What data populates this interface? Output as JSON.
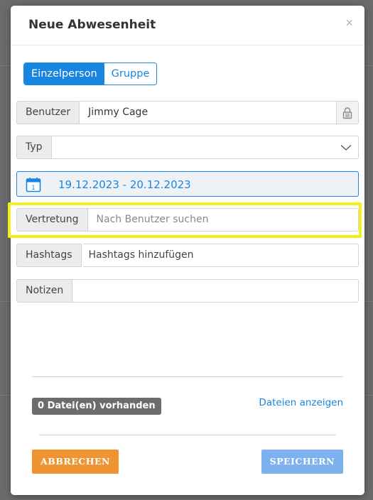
{
  "modal": {
    "title": "Neue Abwesenheit",
    "close_symbol": "×"
  },
  "toggle": {
    "options": [
      "Einzelperson",
      "Gruppe"
    ],
    "selected": "Einzelperson"
  },
  "fields": {
    "benutzer": {
      "label": "Benutzer",
      "value": "Jimmy Cage",
      "locked": true,
      "icon": "lock-icon"
    },
    "typ": {
      "label": "Typ",
      "value": "",
      "icon": "chevron-down-icon"
    },
    "date_range": {
      "value": "19.12.2023 - 20.12.2023",
      "icon": "calendar-icon",
      "calendar_day": "1"
    },
    "vertretung": {
      "label": "Vertretung",
      "placeholder": "Nach Benutzer suchen"
    },
    "hashtags": {
      "label": "Hashtags",
      "placeholder": "Hashtags hinzufügen"
    },
    "notizen": {
      "label": "Notizen",
      "value": ""
    }
  },
  "files": {
    "badge": "0 Datei(en) vorhanden",
    "link": "Dateien anzeigen"
  },
  "footer": {
    "cancel_label": "ABBRECHEN",
    "save_label": "SPEICHERN"
  },
  "colors": {
    "accent": "#1a85e0",
    "cancel": "#ef9433",
    "save": "#7cb2f0",
    "highlight": "#f2f21a",
    "badge": "#6c6c6c"
  }
}
